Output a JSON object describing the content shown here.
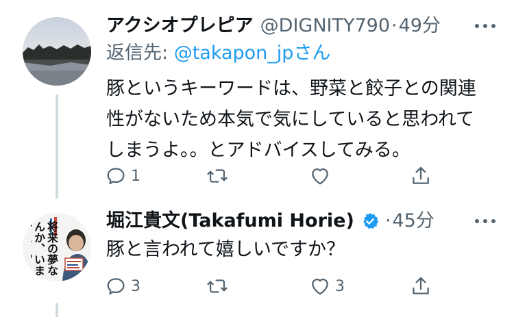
{
  "tweets": [
    {
      "name": "アクシオプレピア",
      "handle": "@DIGNITY790",
      "separator": "·",
      "time": "49分",
      "reply_prefix": "返信先: ",
      "reply_mention": "@takapon_jp",
      "reply_suffix": "さん",
      "text_lines": [
        "豚というキーワードは、野菜と餃子との関連",
        "性がないため本気で気にしていると思われて",
        "しまうよ。。とアドバイスしてみる。"
      ],
      "reply_count": "1",
      "retweet_count": "",
      "like_count": ""
    },
    {
      "name": "堀江貴文(Takafumi Horie)",
      "verified": true,
      "separator": "·",
      "time": "45分",
      "text_lines": [
        "豚と言われて嬉しいですか？"
      ],
      "reply_count": "3",
      "retweet_count": "",
      "like_count": "3"
    }
  ],
  "book_cover_text": "将来の夢なんか、いま叶えろ。",
  "colors": {
    "text": "#0f1419",
    "secondary": "#536471",
    "link": "#1d9bf0",
    "verified": "#1d9bf0",
    "thread_line": "#cfd9de"
  },
  "icons": {
    "reply": "speech-bubble-icon",
    "retweet": "retweet-arrows-icon",
    "like": "heart-icon",
    "share": "share-upload-icon",
    "more": "three-dots-icon",
    "verified": "verified-badge-icon"
  }
}
